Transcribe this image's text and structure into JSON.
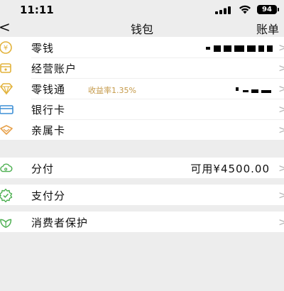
{
  "status_bar": {
    "time": "11:11",
    "battery": "94"
  },
  "nav": {
    "back_icon": "chevron-left-icon",
    "title": "钱包",
    "right_label": "账单"
  },
  "groups": [
    {
      "rows": [
        {
          "label": "零钱",
          "icon": "coin-icon",
          "value_masked": true
        },
        {
          "label": "经营账户",
          "icon": "merchant-account-icon"
        },
        {
          "label": "零钱通",
          "icon": "diamond-icon",
          "tag": "收益率1.35%",
          "value_masked": true
        },
        {
          "label": "银行卡",
          "icon": "bank-card-icon"
        },
        {
          "label": "亲属卡",
          "icon": "family-card-icon"
        }
      ]
    },
    {
      "rows": [
        {
          "label": "分付",
          "icon": "fenfu-cloud-icon",
          "value": "可用¥4500.00"
        }
      ]
    },
    {
      "rows": [
        {
          "label": "支付分",
          "icon": "pay-score-icon"
        }
      ]
    },
    {
      "rows": [
        {
          "label": "消费者保护",
          "icon": "consumer-protection-icon"
        }
      ]
    }
  ],
  "colors": {
    "icon_gold": "#e2b23a",
    "icon_green": "#4caf50",
    "icon_blue": "#3d8fd6",
    "icon_orange": "#e7a14a",
    "tag_gold": "#c59a4a",
    "background": "#ededed",
    "chevron": "#b5b5b5"
  }
}
